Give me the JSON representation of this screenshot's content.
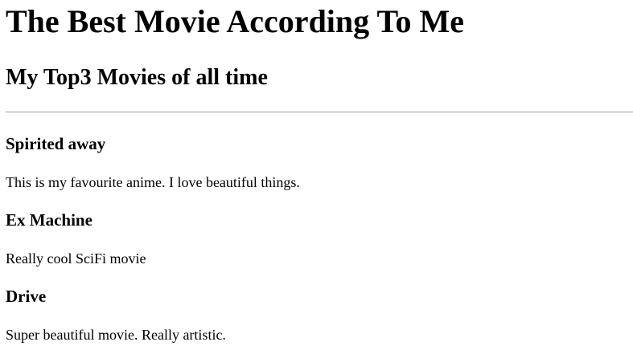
{
  "page": {
    "title": "The Best Movie According To Me",
    "subtitle": "My Top3 Movies of all time"
  },
  "movies": [
    {
      "title": "Spirited away",
      "description": "This is my favourite anime. I love beautiful things."
    },
    {
      "title": "Ex Machine",
      "description": "Really cool SciFi movie"
    },
    {
      "title": "Drive",
      "description": "Super beautiful movie. Really artistic."
    }
  ]
}
